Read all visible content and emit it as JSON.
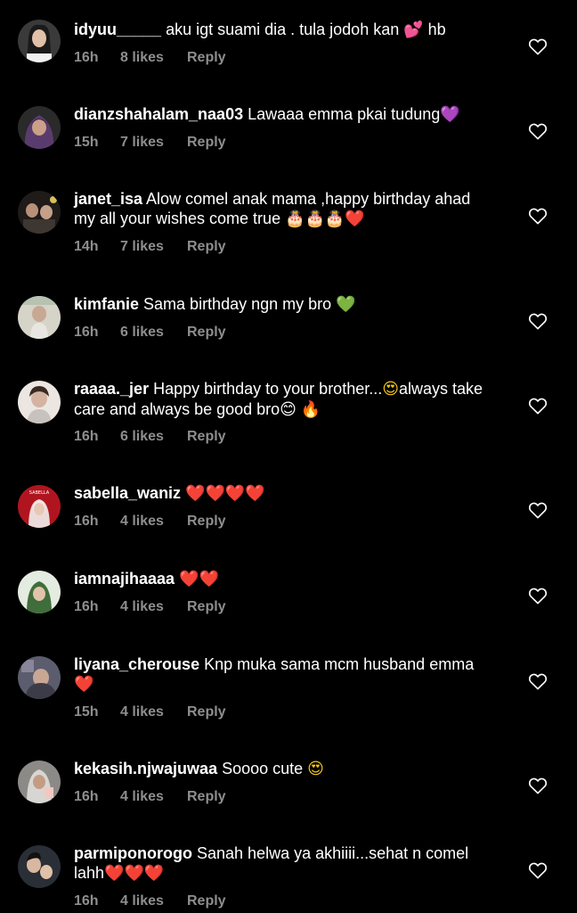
{
  "comments": [
    {
      "username": "idyuu_____",
      "text": " aku igt suami dia . tula jodoh kan ",
      "emoji_after": "💕",
      "emoji_color": "pink",
      "trailing_text": " hb",
      "time": "16h",
      "likes": "8 likes",
      "reply": "Reply",
      "avatar_color": "#3a3a3a"
    },
    {
      "username": "dianzshahalam_naa03",
      "text": " Lawaaa emma pkai tudung",
      "emoji_after": "💜",
      "emoji_color": "purple",
      "trailing_text": "",
      "time": "15h",
      "likes": "7 likes",
      "reply": "Reply",
      "avatar_color": "#5a3b6e"
    },
    {
      "username": "janet_isa",
      "text": " Alow comel anak mama ,happy birthday ahad my all your wishes come true ",
      "emoji_after": "🎂🎂🎂❤️",
      "emoji_color": "cake",
      "trailing_text": "",
      "time": "14h",
      "likes": "7 likes",
      "reply": "Reply",
      "avatar_color": "#2e2a27"
    },
    {
      "username": "kimfanie",
      "text": " Sama birthday ngn my bro ",
      "emoji_after": "💚",
      "emoji_color": "green",
      "trailing_text": "",
      "time": "16h",
      "likes": "6 likes",
      "reply": "Reply",
      "avatar_color": "#c9c6bb"
    },
    {
      "username": "raaaa._jer",
      "text": " Happy birthday to your brother...",
      "emoji_after": "😍",
      "emoji_color": "yellow",
      "trailing_text": "always take care  and always be good bro😊 🔥",
      "time": "16h",
      "likes": "6 likes",
      "reply": "Reply",
      "avatar_color": "#d8d0cc"
    },
    {
      "username": "sabella_waniz",
      "text": " ",
      "emoji_after": "❤️❤️❤️❤️",
      "emoji_color": "heart",
      "trailing_text": "",
      "time": "16h",
      "likes": "4 likes",
      "reply": "Reply",
      "avatar_color": "#b0151f"
    },
    {
      "username": "iamnajihaaaa",
      "text": " ",
      "emoji_after": "❤️❤️",
      "emoji_color": "heart",
      "trailing_text": "",
      "time": "16h",
      "likes": "4 likes",
      "reply": "Reply",
      "avatar_color": "#c8d6c4"
    },
    {
      "username": "liyana_cherouse",
      "text": " Knp muka sama mcm husband emma",
      "emoji_after": "❤️",
      "emoji_color": "heart",
      "trailing_text": "",
      "time": "15h",
      "likes": "4 likes",
      "reply": "Reply",
      "avatar_color": "#5b5d6e"
    },
    {
      "username": "kekasih.njwajuwaa",
      "text": " Soooo cute ",
      "emoji_after": "😍",
      "emoji_color": "yellow",
      "trailing_text": "",
      "time": "16h",
      "likes": "4 likes",
      "reply": "Reply",
      "avatar_color": "#8c8a86"
    },
    {
      "username": "parmiponorogo",
      "text": " Sanah helwa ya akhiiii...sehat n comel lahh",
      "emoji_after": "❤️❤️❤️",
      "emoji_color": "heart",
      "trailing_text": "",
      "time": "16h",
      "likes": "4 likes",
      "reply": "Reply",
      "avatar_color": "#3a3f48"
    }
  ],
  "icons": {
    "like": "heart-outline-icon"
  },
  "colors": {
    "background": "#000000",
    "text": "#ffffff",
    "meta": "#8e8e8e"
  }
}
